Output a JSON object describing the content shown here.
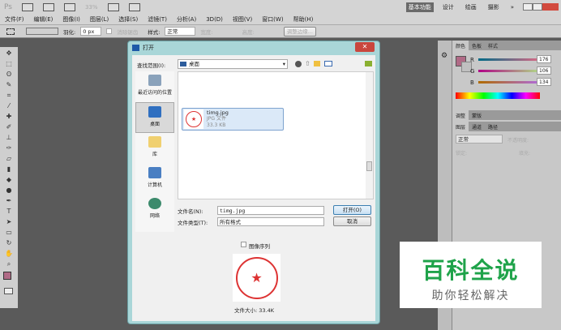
{
  "app": {
    "logo": "Ps",
    "zoom": "33%"
  },
  "workspaces": [
    "基本功能",
    "设计",
    "绘画",
    "摄影",
    "»"
  ],
  "menu": [
    "文件(F)",
    "编辑(E)",
    "图像(I)",
    "图层(L)",
    "选择(S)",
    "滤镜(T)",
    "分析(A)",
    "3D(D)",
    "视图(V)",
    "窗口(W)",
    "帮助(H)"
  ],
  "options": {
    "feather_label": "羽化:",
    "feather_value": "0 px",
    "antialias": "消除锯齿",
    "style_label": "样式:",
    "style_value": "正常",
    "width_label": "宽度:",
    "height_label": "高度:",
    "refine_edge": "调整边缘..."
  },
  "dialog": {
    "title": "打开",
    "look_in_label": "查找范围(I):",
    "look_in_value": "桌面",
    "places": [
      "最近访问的位置",
      "桌面",
      "库",
      "计算机",
      "网络"
    ],
    "file": {
      "name": "timg.jpg",
      "type": "JPG 文件",
      "size": "33.3 KB"
    },
    "filename_label": "文件名(N):",
    "filename_value": "timg.jpg",
    "filetype_label": "文件类型(T):",
    "filetype_value": "所有格式",
    "open_button": "打开(O)",
    "cancel_button": "取消",
    "image_sequence": "图像序列",
    "filesize": "文件大小: 33.4K"
  },
  "color_panel": {
    "tabs": [
      "颜色",
      "色板",
      "样式"
    ],
    "r": "176",
    "g": "106",
    "b": "134",
    "r_label": "R",
    "g_label": "G",
    "b_label": "B",
    "fg": "#b06a86"
  },
  "adjust_panel": {
    "tabs": [
      "调整",
      "蒙版"
    ]
  },
  "layers_panel": {
    "tabs": [
      "图层",
      "通道",
      "路径"
    ],
    "blend": "正常",
    "opacity_label": "不透明度:",
    "lock_label": "锁定:",
    "fill_label": "填充:"
  },
  "watermark": {
    "title": "百科全说",
    "subtitle": "助你轻松解决",
    "color": "#1fa34a"
  }
}
